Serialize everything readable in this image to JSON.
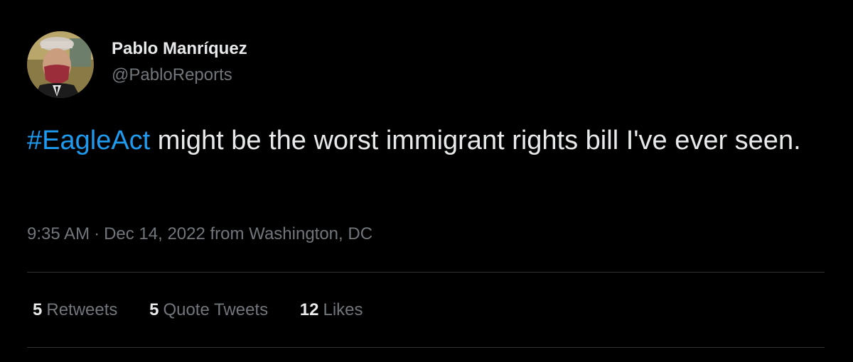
{
  "author": {
    "display_name": "Pablo Manríquez",
    "handle": "@PabloReports",
    "avatar": "painted-portrait-avatar"
  },
  "tweet": {
    "hashtag": "#EagleAct",
    "text": " might be the worst immigrant rights bill I've ever seen."
  },
  "meta": {
    "time": "9:35 AM",
    "separator": "·",
    "date": "Dec 14, 2022",
    "source": "from Washington, DC"
  },
  "stats": [
    {
      "count": "5",
      "label": "Retweets"
    },
    {
      "count": "5",
      "label": "Quote Tweets"
    },
    {
      "count": "12",
      "label": "Likes"
    }
  ],
  "colors": {
    "background": "#000000",
    "text": "#e7e9ea",
    "muted": "#71767b",
    "link": "#1d9bf0",
    "divider": "#2f3336"
  }
}
